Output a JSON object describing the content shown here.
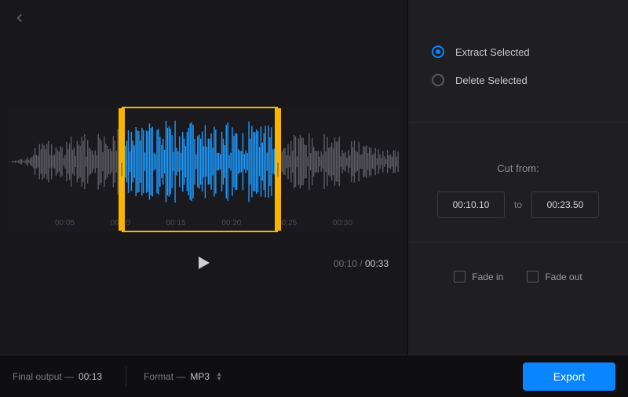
{
  "options": {
    "extract_label": "Extract Selected",
    "delete_label": "Delete Selected",
    "selected": "extract"
  },
  "cut": {
    "title": "Cut from:",
    "from": "00:10.10",
    "to_label": "to",
    "to": "00:23.50"
  },
  "fades": {
    "in_label": "Fade in",
    "out_label": "Fade out"
  },
  "playback": {
    "current": "00:10",
    "sep": "/",
    "total": "00:33"
  },
  "ticks": [
    "00:05",
    "00:10",
    "00:15",
    "00:20",
    "00:25",
    "00:30"
  ],
  "selection": {
    "left_pct": 29,
    "width_pct": 40
  },
  "bottom": {
    "final_output_label": "Final output  —",
    "final_output_value": "00:13",
    "format_label": "Format  —",
    "format_value": "MP3"
  },
  "export_label": "Export"
}
